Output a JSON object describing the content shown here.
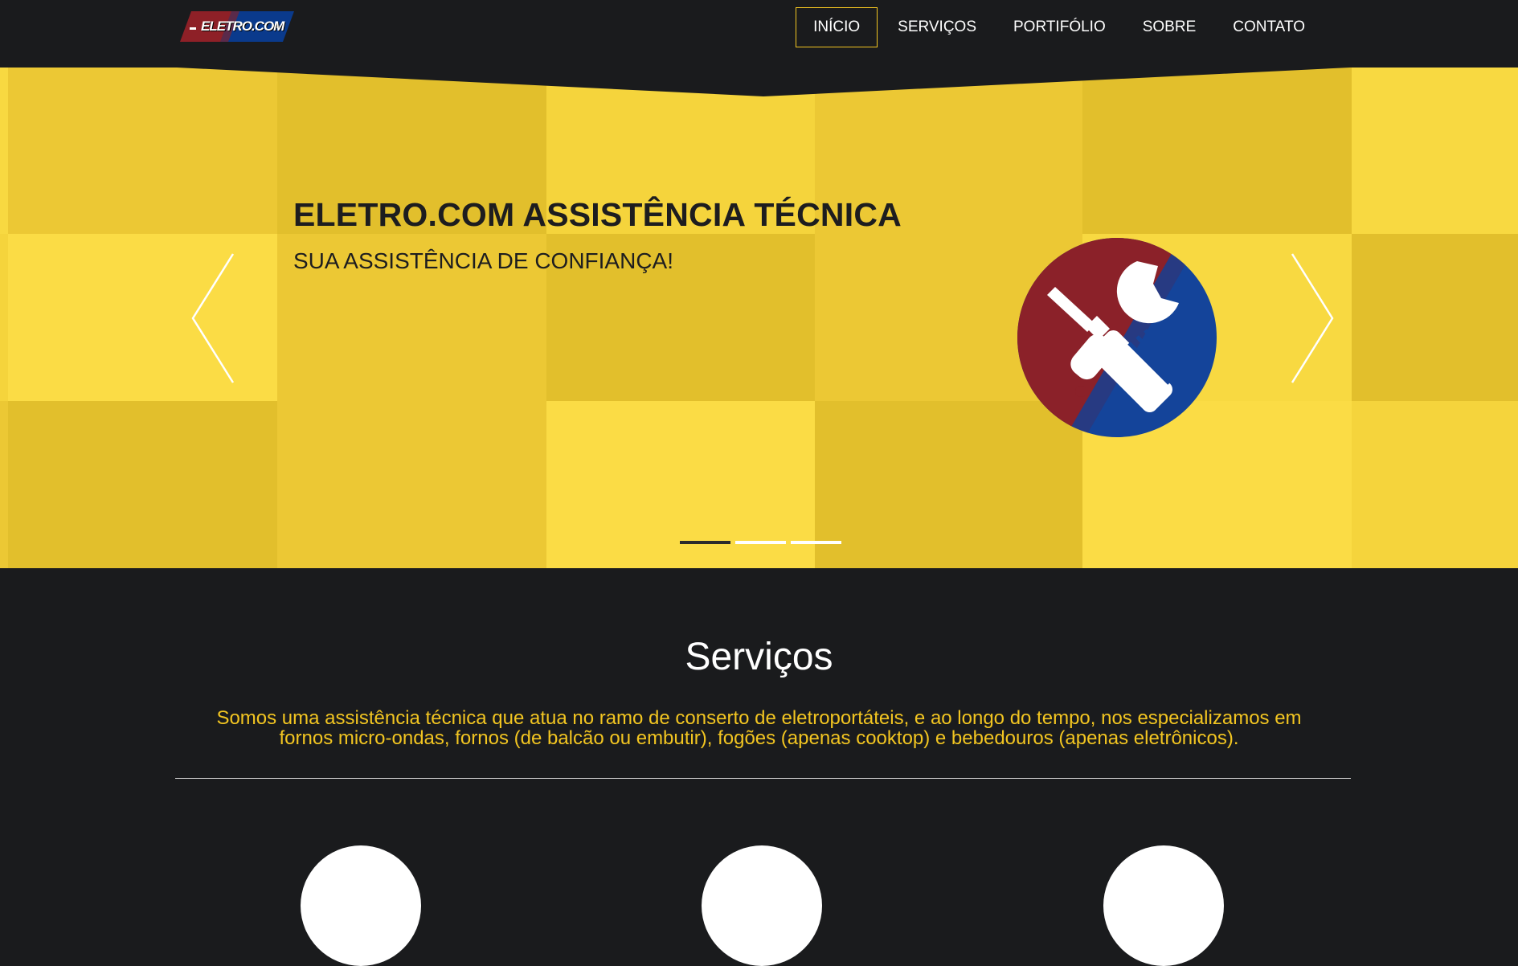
{
  "brand": {
    "logo_text": "ELETRO.COM",
    "colors": {
      "red": "#8e2027",
      "blue": "#0a3a8c"
    }
  },
  "nav": {
    "items": [
      {
        "label": "INÍCIO",
        "active": true
      },
      {
        "label": "SERVIÇOS",
        "active": false
      },
      {
        "label": "PORTIFÓLIO",
        "active": false
      },
      {
        "label": "SOBRE",
        "active": false
      },
      {
        "label": "CONTATO",
        "active": false
      }
    ],
    "active_border_color": "#f2c521"
  },
  "hero": {
    "title": "ELETRO.COM ASSISTÊNCIA TÉCNICA",
    "subtitle": "SUA ASSISTÊNCIA DE CONFIANÇA!",
    "emblem_icon": "tools-icon",
    "prev_icon": "chevron-left-icon",
    "next_icon": "chevron-right-icon",
    "slide_count": 3,
    "active_slide": 1,
    "background_color": "#f6d33a"
  },
  "services": {
    "title": "Serviços",
    "description": "Somos uma assistência técnica que atua no ramo de conserto de eletroportáteis, e ao longo do tempo, nos especializamos em fornos micro-ondas, fornos (de balcão ou embutir), fogões (apenas cooktop) e bebedouros (apenas eletrônicos).",
    "accent_color": "#f2c521"
  },
  "theme": {
    "background": "#1a1b1d",
    "text": "#ffffff"
  }
}
